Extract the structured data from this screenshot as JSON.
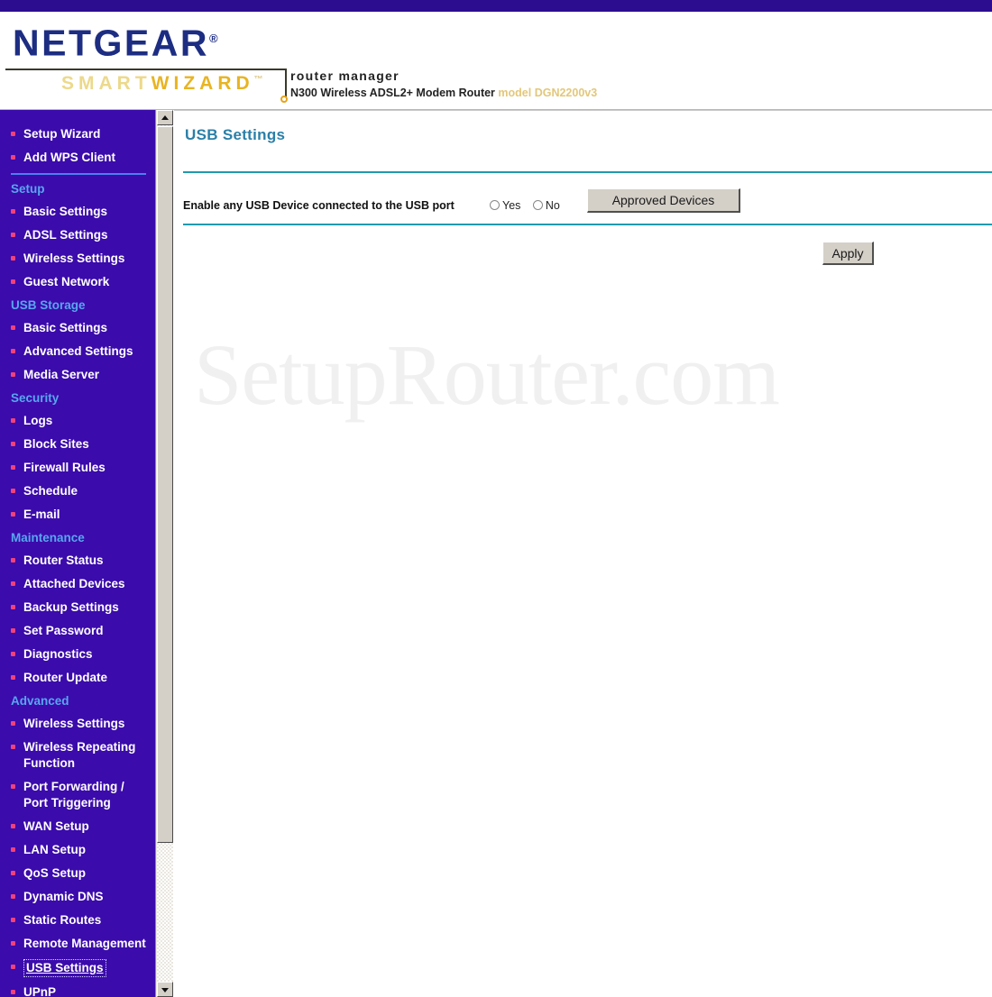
{
  "header": {
    "brand": "NETGEAR",
    "brand_tm": "®",
    "smart": "SMART",
    "wizard": "WIZARD",
    "wizard_tm": "™",
    "product_tagline": "router manager",
    "device_name": "N300 Wireless ADSL2+ Modem Router",
    "model_label": "model DGN2200v3",
    "accent_purple": "#2c0d90",
    "accent_gold": "#e8b423",
    "brand_blue": "#1d2d82"
  },
  "sidebar": {
    "background": "#3b0bab",
    "section_color": "#58a6ef",
    "bullet_color": "#f0427a",
    "groups": [
      {
        "section": null,
        "items": [
          {
            "label": "Setup Wizard",
            "active": false
          },
          {
            "label": "Add WPS Client",
            "active": false
          }
        ],
        "divider_after": true
      },
      {
        "section": "Setup",
        "items": [
          {
            "label": "Basic Settings",
            "active": false
          },
          {
            "label": "ADSL Settings",
            "active": false
          },
          {
            "label": "Wireless Settings",
            "active": false
          },
          {
            "label": "Guest Network",
            "active": false
          }
        ],
        "divider_after": false
      },
      {
        "section": "USB Storage",
        "items": [
          {
            "label": "Basic Settings",
            "active": false
          },
          {
            "label": "Advanced Settings",
            "active": false
          },
          {
            "label": "Media Server",
            "active": false
          }
        ],
        "divider_after": false
      },
      {
        "section": "Security",
        "items": [
          {
            "label": "Logs",
            "active": false
          },
          {
            "label": "Block Sites",
            "active": false
          },
          {
            "label": "Firewall Rules",
            "active": false
          },
          {
            "label": "Schedule",
            "active": false
          },
          {
            "label": "E-mail",
            "active": false
          }
        ],
        "divider_after": false
      },
      {
        "section": "Maintenance",
        "items": [
          {
            "label": "Router Status",
            "active": false
          },
          {
            "label": "Attached Devices",
            "active": false
          },
          {
            "label": "Backup Settings",
            "active": false
          },
          {
            "label": "Set Password",
            "active": false
          },
          {
            "label": "Diagnostics",
            "active": false
          },
          {
            "label": "Router Update",
            "active": false
          }
        ],
        "divider_after": false
      },
      {
        "section": "Advanced",
        "items": [
          {
            "label": "Wireless Settings",
            "active": false
          },
          {
            "label": "Wireless Repeating Function",
            "active": false
          },
          {
            "label": "Port Forwarding / Port Triggering",
            "active": false
          },
          {
            "label": "WAN Setup",
            "active": false
          },
          {
            "label": "LAN Setup",
            "active": false
          },
          {
            "label": "QoS Setup",
            "active": false
          },
          {
            "label": "Dynamic DNS",
            "active": false
          },
          {
            "label": "Static Routes",
            "active": false
          },
          {
            "label": "Remote Management",
            "active": false
          },
          {
            "label": "USB Settings",
            "active": true
          },
          {
            "label": "UPnP",
            "active": false
          }
        ],
        "divider_after": false
      }
    ],
    "scrollbar": {
      "up_icon": "triangle-up-icon",
      "down_icon": "triangle-down-icon"
    }
  },
  "main": {
    "title": "USB Settings",
    "field": {
      "label": "Enable any USB Device connected to the USB port",
      "options": [
        {
          "label": "Yes",
          "selected": false
        },
        {
          "label": "No",
          "selected": false
        }
      ]
    },
    "approved_devices_button": "Approved Devices",
    "apply_button": "Apply",
    "watermark": "SetupRouter.com",
    "rule_color": "#1f9aad",
    "title_color": "#2a7fa8"
  }
}
